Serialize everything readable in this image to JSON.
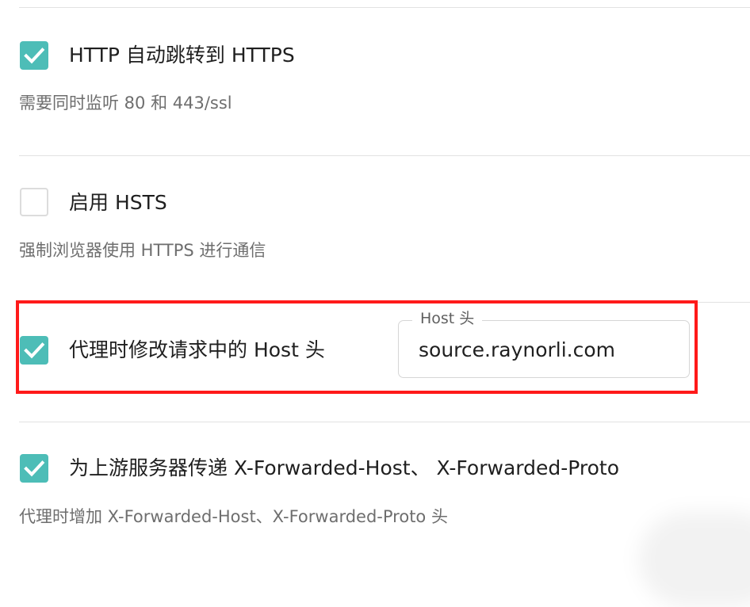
{
  "colors": {
    "accent": "#4dbdb7",
    "highlight": "#ff1a1a"
  },
  "settings": [
    {
      "label": "HTTP 自动跳转到 HTTPS",
      "description": "需要同时监听 80 和 443/ssl",
      "checked": true,
      "check_icon": "check-icon"
    },
    {
      "label": "启用 HSTS",
      "description": "强制浏览器使用 HTTPS 进行通信",
      "checked": false
    },
    {
      "label": "代理时修改请求中的 Host 头",
      "checked": true,
      "check_icon": "check-icon",
      "field": {
        "label": "Host 头",
        "value": "source.raynorli.com"
      }
    },
    {
      "label": "为上游服务器传递 X-Forwarded-Host、 X-Forwarded-Proto",
      "description": "代理时增加 X-Forwarded-Host、X-Forwarded-Proto 头",
      "checked": true,
      "check_icon": "check-icon"
    }
  ]
}
